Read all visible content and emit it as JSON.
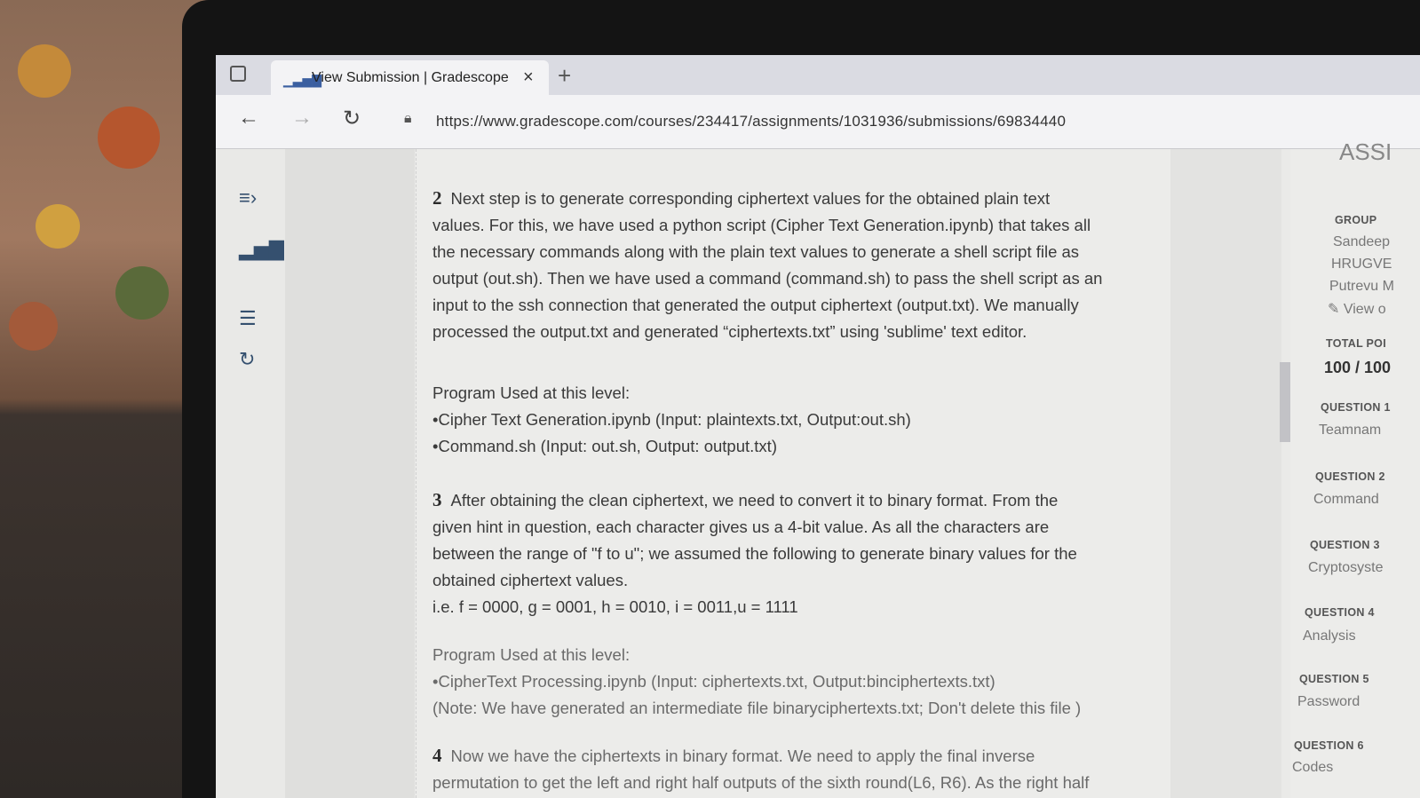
{
  "browser": {
    "tab_title": "View Submission | Gradescope",
    "tab_close": "×",
    "new_tab": "+",
    "url": "https://www.gradescope.com/courses/234417/assignments/1031936/submissions/69834440"
  },
  "document": {
    "section2": {
      "number": "2",
      "lines": [
        "Next step is to generate corresponding ciphertext values for the obtained plain text",
        "values. For this, we have used a python script (Cipher Text Generation.ipynb) that takes all",
        "the necessary commands along with the plain text values to generate a shell script file as",
        "output (out.sh). Then we have used a command (command.sh) to pass the shell script as an",
        "input to the ssh connection that generated the output ciphertext (output.txt). We manually",
        "processed the output.txt and generated “ciphertexts.txt” using 'sublime' text editor."
      ],
      "program_heading": "Program Used at this level:",
      "programs": [
        "•Cipher Text Generation.ipynb (Input: plaintexts.txt, Output:out.sh)",
        "•Command.sh (Input: out.sh, Output: output.txt)"
      ]
    },
    "section3": {
      "number": "3",
      "lines": [
        "After obtaining the clean ciphertext, we need to convert it to binary format. From the",
        "given hint in question, each character gives us a 4-bit value. As all the characters are",
        "between the range of \"f to u\"; we assumed the following to generate binary values for the",
        "obtained ciphertext values.",
        "i.e. f = 0000, g = 0001, h = 0010, i = 0011,u = 1111"
      ],
      "program_heading": "Program Used at this level:",
      "programs": [
        "•CipherText Processing.ipynb (Input: ciphertexts.txt, Output:binciphertexts.txt)",
        "(Note: We have generated an intermediate file binaryciphertexts.txt; Don't delete this file )"
      ]
    },
    "section4": {
      "number": "4",
      "lines": [
        "Now we have the ciphertexts in binary format. We need to apply the final inverse",
        "permutation to get the left and right half outputs of the sixth round(L6, R6). As the right half"
      ]
    }
  },
  "sidebar": {
    "header": "ASSI",
    "group_label": "GROUP",
    "members": [
      "Sandeep",
      "HRUGVE",
      "Putrevu M"
    ],
    "view_link": "View o",
    "total_points_label": "TOTAL POI",
    "total_points": "100 / 100",
    "questions": [
      {
        "label": "QUESTION 1",
        "name": "Teamnam"
      },
      {
        "label": "QUESTION 2",
        "name": "Command"
      },
      {
        "label": "QUESTION 3",
        "name": "Cryptosyste"
      },
      {
        "label": "QUESTION 4",
        "name": "Analysis"
      },
      {
        "label": "QUESTION 5",
        "name": "Password"
      },
      {
        "label": "QUESTION 6",
        "name": "Codes"
      }
    ]
  }
}
